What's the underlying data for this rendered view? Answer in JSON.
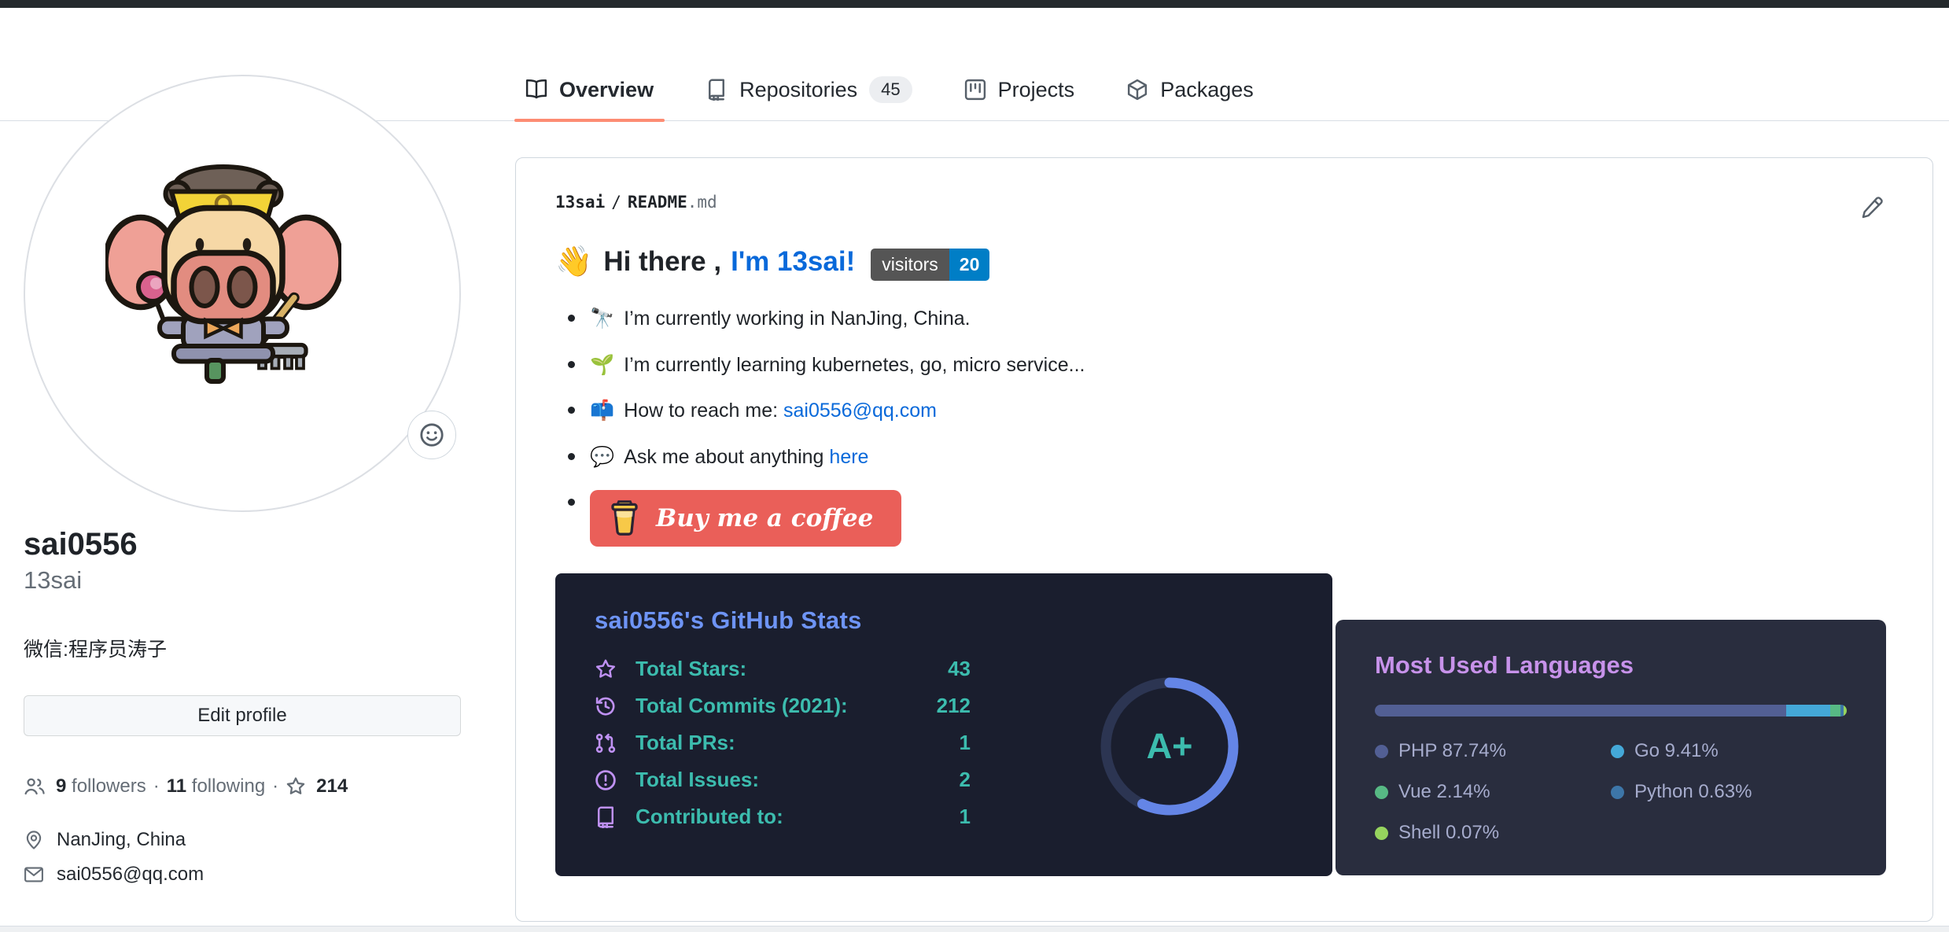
{
  "topnav": {
    "tabs": [
      {
        "label": "Overview",
        "icon": "book-icon",
        "count": null,
        "active": true
      },
      {
        "label": "Repositories",
        "icon": "repo-icon",
        "count": "45",
        "active": false
      },
      {
        "label": "Projects",
        "icon": "project-icon",
        "count": null,
        "active": false
      },
      {
        "label": "Packages",
        "icon": "package-icon",
        "count": null,
        "active": false
      }
    ]
  },
  "sidebar": {
    "name": "sai0556",
    "username": "13sai",
    "bio": "微信:程序员涛子",
    "edit_profile_label": "Edit profile",
    "followers_count": "9",
    "followers_label": "followers",
    "following_count": "11",
    "following_label": "following",
    "stars_count": "214",
    "separator": "·",
    "location": "NanJing, China",
    "email": "sai0556@qq.com"
  },
  "readme": {
    "breadcrumb": {
      "user": "13sai",
      "separator": "/",
      "file": "README",
      "ext": ".md"
    },
    "heading": {
      "emoji": "👋",
      "text": "Hi there ,",
      "link": "I'm 13sai!"
    },
    "visitors_badge": {
      "label": "visitors",
      "count": "20"
    },
    "bullets": [
      {
        "emoji": "🔭",
        "text": "I’m currently working in NanJing, China.",
        "link": ""
      },
      {
        "emoji": "🌱",
        "text": "I’m currently learning kubernetes, go, micro service...",
        "link": ""
      },
      {
        "emoji": "📫",
        "text": "How to reach me: ",
        "link": "sai0556@qq.com"
      },
      {
        "emoji": "💬",
        "text": "Ask me about anything ",
        "link": "here"
      }
    ],
    "coffee_button": {
      "label": "Buy me a coffee"
    }
  },
  "stats_card": {
    "title": "sai0556's GitHub Stats",
    "rows": [
      {
        "icon": "star-icon",
        "label": "Total Stars:",
        "value": "43"
      },
      {
        "icon": "history-icon",
        "label": "Total Commits (2021):",
        "value": "212"
      },
      {
        "icon": "pull-request-icon",
        "label": "Total PRs:",
        "value": "1"
      },
      {
        "icon": "issue-icon",
        "label": "Total Issues:",
        "value": "2"
      },
      {
        "icon": "repo-book-icon",
        "label": "Contributed to:",
        "value": "1"
      }
    ],
    "rank": "A+"
  },
  "languages_card": {
    "title": "Most Used Languages",
    "languages": [
      {
        "name": "PHP",
        "percent": "87.74%",
        "color": "#525f94"
      },
      {
        "name": "Go",
        "percent": "9.41%",
        "color": "#44a8d8"
      },
      {
        "name": "Vue",
        "percent": "2.14%",
        "color": "#57b984"
      },
      {
        "name": "Python",
        "percent": "0.63%",
        "color": "#3d76a8"
      },
      {
        "name": "Shell",
        "percent": "0.07%",
        "color": "#96d45e"
      }
    ]
  },
  "colors": {
    "topbar": "#24292c",
    "accent": "#fd8c73",
    "link": "#0969da",
    "badge-gray": "#555555",
    "badge-blue": "#007ec6",
    "coffee": "#ea5f59",
    "stats-bg": "#1a1e2e",
    "stats-title": "#6e94f5",
    "stats-icon": "#bf91f3",
    "stats-text": "#3cbcae",
    "ring-blue": "#6485e6",
    "ring-track": "#2c3552",
    "langs-bg": "#292d3e",
    "langs-title": "#c792ea",
    "langs-text": "#a6accd"
  }
}
